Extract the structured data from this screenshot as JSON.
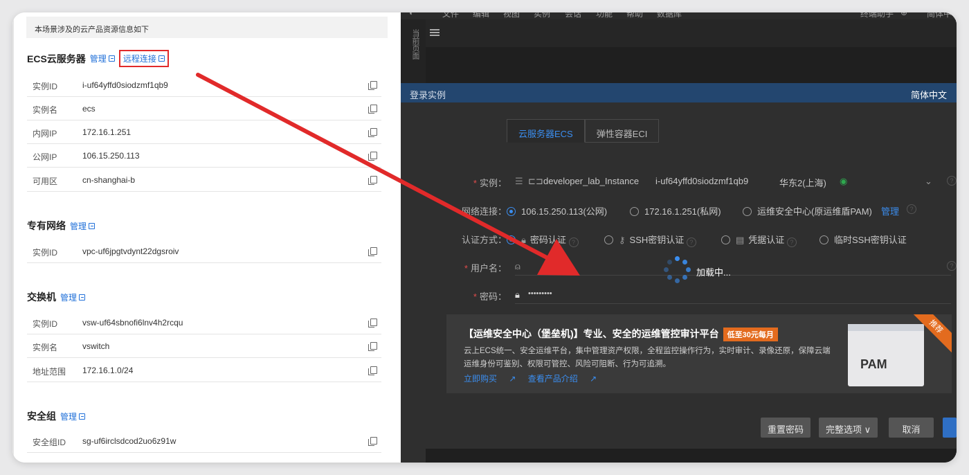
{
  "left_panel": {
    "banner": "本场景涉及的云产品资源信息如下",
    "ecs": {
      "title": "ECS云服务器",
      "manage": "管理",
      "remote": "远程连接",
      "rows": [
        {
          "key": "实例ID",
          "value": "i-uf64yffd0siodzmf1qb9"
        },
        {
          "key": "实例名",
          "value": "ecs"
        },
        {
          "key": "内网IP",
          "value": "172.16.1.251"
        },
        {
          "key": "公网IP",
          "value": "106.15.250.113"
        },
        {
          "key": "可用区",
          "value": "cn-shanghai-b"
        }
      ]
    },
    "vpc": {
      "title": "专有网络",
      "manage": "管理",
      "rows": [
        {
          "key": "实例ID",
          "value": "vpc-uf6jpgtvdynt22dgsroiv"
        }
      ]
    },
    "vswitch": {
      "title": "交换机",
      "manage": "管理",
      "rows": [
        {
          "key": "实例ID",
          "value": "vsw-uf64sbnofi6lnv4h2rcqu"
        },
        {
          "key": "实例名",
          "value": "vswitch"
        },
        {
          "key": "地址范围",
          "value": "172.16.1.0/24"
        }
      ]
    },
    "sg": {
      "title": "安全组",
      "manage": "管理",
      "rows": [
        {
          "key": "安全组ID",
          "value": "sg-uf6irclsdcod2uo6z91w"
        }
      ]
    }
  },
  "right_panel": {
    "menu": [
      "文件",
      "编辑",
      "视图",
      "实例",
      "会话",
      "功能",
      "帮助",
      "数据库"
    ],
    "menu_right": [
      "终端助手",
      "简体中"
    ],
    "side_label": "当前页面",
    "dialog": {
      "title": "登录实例",
      "lang": "简体中文",
      "tabs": [
        "云服务器ECS",
        "弹性容器ECI"
      ],
      "instance_label": "实例：",
      "instance_name": "developer_lab_Instance",
      "instance_id": "i-uf64yffd0siodzmf1qb9",
      "instance_region": "华东2(上海)",
      "network_label": "网络连接：",
      "network_options": [
        "106.15.250.113(公网)",
        "172.16.1.251(私网)",
        "运维安全中心(原运维盾PAM)"
      ],
      "network_manage": "管理",
      "auth_label": "认证方式：",
      "auth_options": [
        "密码认证",
        "SSH密钥认证",
        "凭据认证",
        "临时SSH密钥认证"
      ],
      "user_label": "用户名：",
      "password_label": "密码：",
      "password_value": "•••••••••",
      "loading": "加载中...",
      "promo": {
        "title": "【运维安全中心（堡垒机)】专业、安全的运维管控审计平台",
        "badge": "低至30元每月",
        "desc": "云上ECS统一、安全运维平台，集中管理资产权限，全程监控操作行为，实时审计、录像还原，保障云端运维身份可鉴别、权限可管控、风险可阻断、行为可追溯。",
        "buy": "立即购买",
        "intro": "查看产品介绍",
        "ribbon": "推荐",
        "art_text": "PAM"
      },
      "buttons": {
        "reset": "重置密码",
        "full": "完整选项",
        "cancel": "取消"
      }
    }
  },
  "colors": {
    "accent": "#3b8ef0",
    "highlight": "#e12a2a",
    "dialog_header": "#23466f"
  }
}
